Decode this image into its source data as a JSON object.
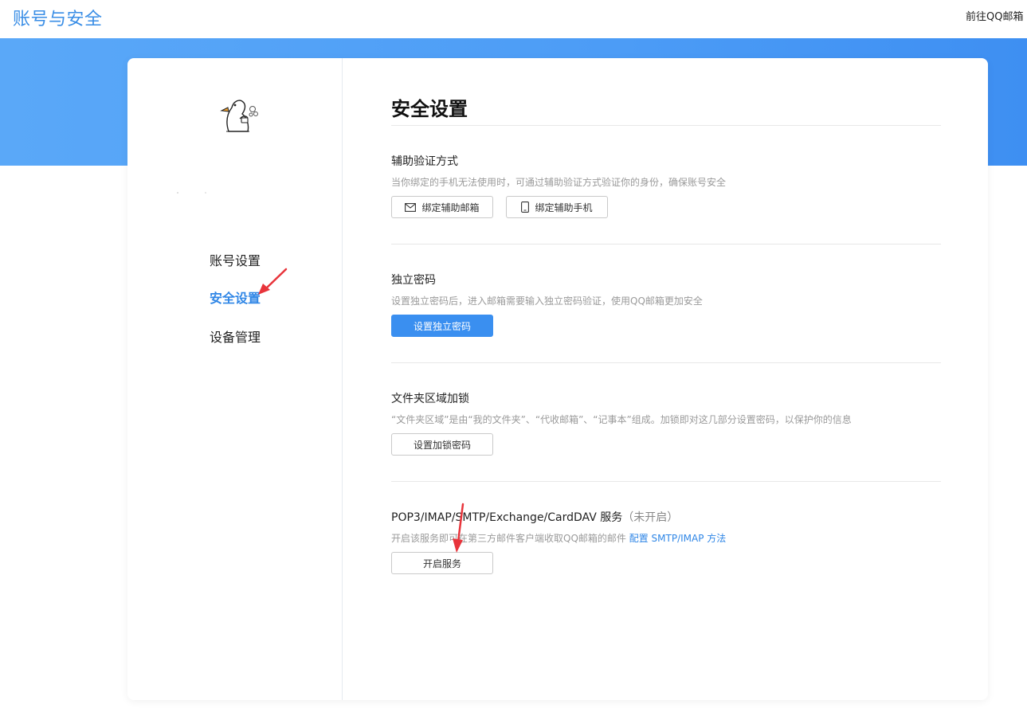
{
  "header": {
    "title": "账号与安全",
    "go_mail": "前往QQ邮箱"
  },
  "sidebar": {
    "items": [
      {
        "label": "账号设置",
        "active": false
      },
      {
        "label": "安全设置",
        "active": true
      },
      {
        "label": "设备管理",
        "active": false
      }
    ]
  },
  "main": {
    "title": "安全设置",
    "sections": [
      {
        "title": "辅助验证方式",
        "desc": "当你绑定的手机无法使用时，可通过辅助验证方式验证你的身份，确保账号安全",
        "buttons": [
          {
            "label": "绑定辅助邮箱",
            "icon": "mail-icon"
          },
          {
            "label": "绑定辅助手机",
            "icon": "phone-icon"
          }
        ]
      },
      {
        "title": "独立密码",
        "desc": "设置独立密码后，进入邮箱需要输入独立密码验证，使用QQ邮箱更加安全",
        "buttons": [
          {
            "label": "设置独立密码",
            "style": "primary"
          }
        ]
      },
      {
        "title": "文件夹区域加锁",
        "desc": "“文件夹区域”是由“我的文件夹”、“代收邮箱”、“记事本”组成。加锁即对这几部分设置密码，以保护你的信息",
        "buttons": [
          {
            "label": "设置加锁密码"
          }
        ]
      },
      {
        "title": "POP3/IMAP/SMTP/Exchange/CardDAV 服务",
        "status": "（未开启）",
        "desc": "开启该服务即可在第三方邮件客户端收取QQ邮箱的邮件",
        "link": "配置 SMTP/IMAP 方法",
        "buttons": [
          {
            "label": "开启服务"
          }
        ]
      }
    ]
  },
  "colors": {
    "accent": "#2f86e6",
    "banner": "#4c9cf6",
    "annotation_arrow": "#e8343b"
  }
}
